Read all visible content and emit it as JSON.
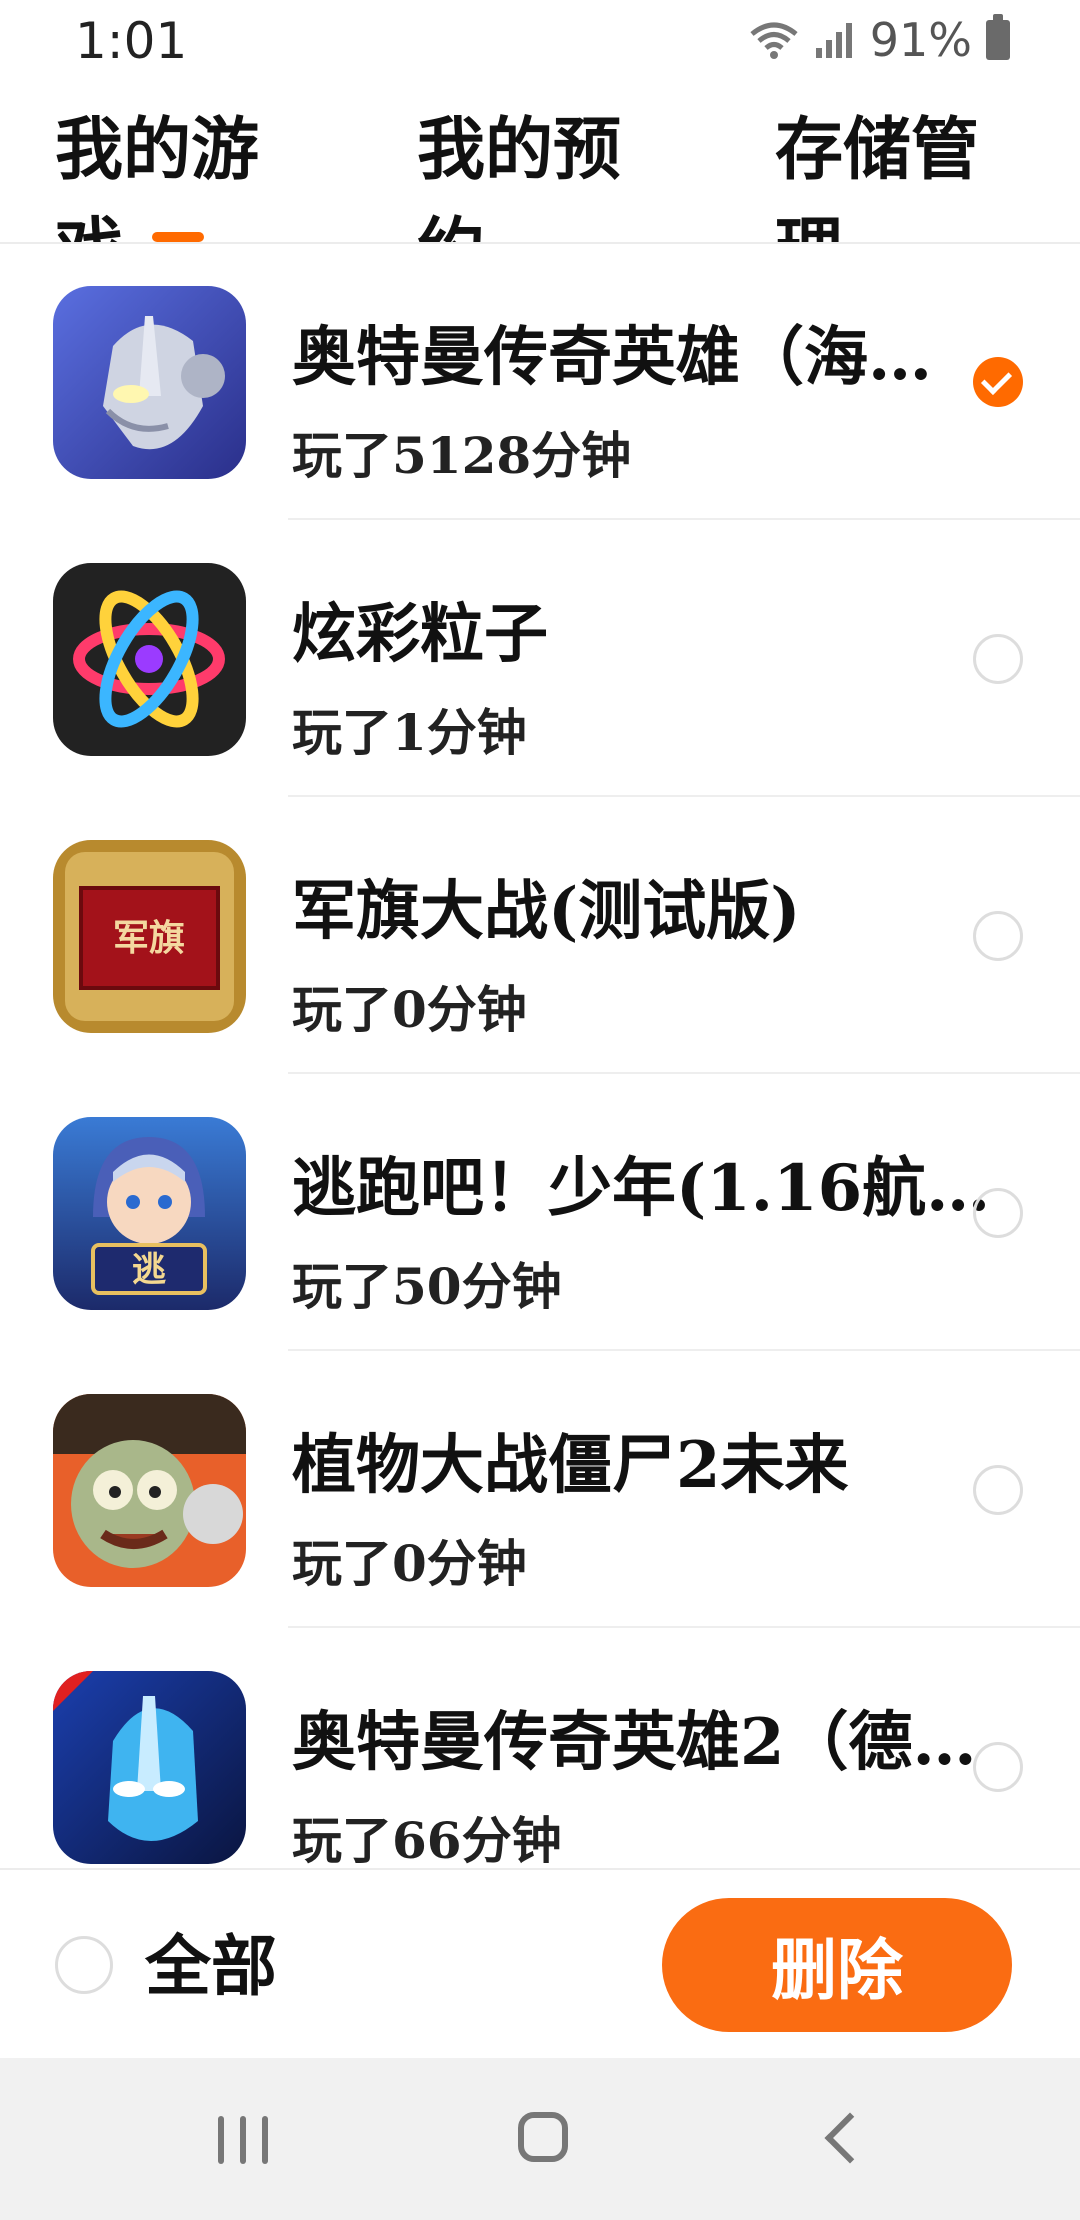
{
  "status_bar": {
    "time": "1:01",
    "battery_pct": "91%",
    "icons": [
      "wifi-icon",
      "signal-icon",
      "battery-icon"
    ]
  },
  "tabs": [
    {
      "label": "我的游戏",
      "active": true
    },
    {
      "label": "我的预约",
      "active": false
    },
    {
      "label": "存储管理",
      "active": false
    }
  ],
  "games": [
    {
      "title": "奥特曼传奇英雄（海…",
      "played": "玩了5128分钟",
      "checked": true,
      "icon": "ultraman-hero-icon"
    },
    {
      "title": "炫彩粒子",
      "played": "玩了1分钟",
      "checked": false,
      "icon": "atom-particle-icon"
    },
    {
      "title": "军旗大战(测试版)",
      "played": "玩了0分钟",
      "checked": false,
      "icon": "army-flag-icon"
    },
    {
      "title": "逃跑吧！少年(1.16航…",
      "played": "玩了50分钟",
      "checked": false,
      "icon": "escape-boy-icon"
    },
    {
      "title": "植物大战僵尸2未来",
      "played": "玩了0分钟",
      "checked": false,
      "icon": "zombie-icon"
    },
    {
      "title": "奥特曼传奇英雄2（德…",
      "played": "玩了66分钟",
      "checked": false,
      "icon": "ultraman-blue-icon"
    }
  ],
  "footer": {
    "select_all_label": "全部",
    "delete_label": "删除"
  },
  "colors": {
    "accent": "#ff6a00"
  }
}
